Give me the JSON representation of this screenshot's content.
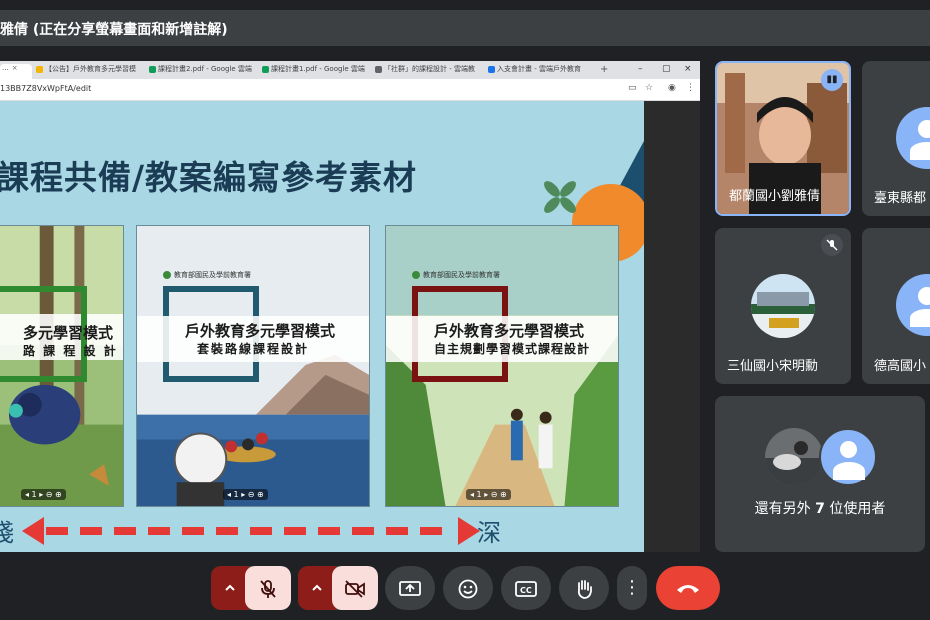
{
  "meeting": {
    "title": "雅倩 (正在分享螢幕畫面和新增註解)"
  },
  "browser": {
    "tabs": [
      {
        "label": "...",
        "color": "#1a73e8"
      },
      {
        "label": "【公告】戶外教育多元學習模",
        "color": "#f4b400"
      },
      {
        "label": "課程計畫2.pdf - Google 雲端",
        "color": "#0f9d58"
      },
      {
        "label": "課程計畫1.pdf - Google 雲端",
        "color": "#0f9d58"
      },
      {
        "label": "「社群」的課程設計 - 雲端教",
        "color": "#5f6368"
      },
      {
        "label": "入支會計畫 - 雲端戶外教育",
        "color": "#1a73e8"
      }
    ],
    "new_tab": "+",
    "url": "13BB7Z8VxWpFtA/edit"
  },
  "slide": {
    "heading": "課程共備/教案編寫參考素材",
    "cards": [
      {
        "title": "多元學習模式",
        "subtitle": "路 課 程 設 計",
        "logo": "教育部國民及學前教育署",
        "frame_color": "#2f8a2f"
      },
      {
        "title": "戶外教育多元學習模式",
        "subtitle": "套裝路線課程設計",
        "logo": "教育部國民及學前教育署",
        "frame_color": "#1f5a6e"
      },
      {
        "title": "戶外教育多元學習模式",
        "subtitle": "自主規劃學習模式課程設計",
        "logo": "教育部國民及學前教育署",
        "frame_color": "#7a1212"
      }
    ],
    "arrow_left_label": "淺",
    "arrow_right_label": "深"
  },
  "participants": [
    {
      "name": "都蘭國小劉雅倩",
      "speaking": true
    },
    {
      "name": "臺東縣都",
      "speaking": false
    },
    {
      "name": "三仙國小宋明勳",
      "muted": true,
      "avatar_text": "三仙國小"
    },
    {
      "name": "德高國小",
      "speaking": false
    }
  ],
  "others": {
    "text_before": "還有另外 ",
    "count": "7",
    "text_after": " 位使用者"
  },
  "controls": {
    "mic_caret": "^",
    "cam_caret": "^",
    "icons": [
      "mic-off-icon",
      "camera-off-icon",
      "present-icon",
      "emoji-icon",
      "captions-icon",
      "raise-hand-icon",
      "more-icon",
      "end-call-icon"
    ]
  },
  "colors": {
    "background": "#202124",
    "end_call": "#ea4335",
    "muted_control": "#f9dedc",
    "accent": "#8ab4f8"
  }
}
